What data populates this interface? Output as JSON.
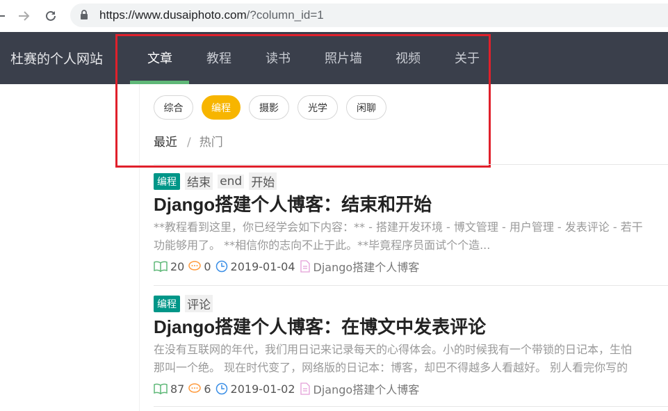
{
  "browser": {
    "url_host": "https://www.dusaiphoto.com",
    "url_path": "/?column_id=1"
  },
  "navbar": {
    "brand": "杜赛的个人网站",
    "items": [
      {
        "label": "文章",
        "active": true
      },
      {
        "label": "教程",
        "active": false
      },
      {
        "label": "读书",
        "active": false
      },
      {
        "label": "照片墙",
        "active": false
      },
      {
        "label": "视频",
        "active": false
      },
      {
        "label": "关于",
        "active": false
      }
    ]
  },
  "filters": {
    "columns": [
      {
        "label": "综合",
        "active": false
      },
      {
        "label": "编程",
        "active": true
      },
      {
        "label": "摄影",
        "active": false
      },
      {
        "label": "光学",
        "active": false
      },
      {
        "label": "闲聊",
        "active": false
      }
    ],
    "sort_latest": "最近",
    "sort_separator": "/",
    "sort_hot": "热门"
  },
  "articles": [
    {
      "category": "编程",
      "tags": [
        "结束",
        "end",
        "开始"
      ],
      "title": "Django搭建个人博客：结束和开始",
      "excerpt_line1": "**教程看到这里，你已经学会如下内容：** - 搭建开发环境 - 博文管理 - 用户管理 - 发表评论 - 若干",
      "excerpt_line2": "功能够用了。 **相信你的志向不止于此。**毕竟程序员面试个个造...",
      "views": "20",
      "comments": "0",
      "date": "2019-01-04",
      "series": "Django搭建个人博客"
    },
    {
      "category": "编程",
      "tags": [
        "评论"
      ],
      "title": "Django搭建个人博客：在博文中发表评论",
      "excerpt_line1": "在没有互联网的年代，我们用日记来记录每天的心得体会。小的时候我有一个带锁的日记本，生怕",
      "excerpt_line2": "那叫一个绝。 现在时代变了，网络版的日记本：博客，却巴不得越多人看越好。 别人看完你写的",
      "views": "87",
      "comments": "6",
      "date": "2019-01-02",
      "series": "Django搭建个人博客"
    }
  ],
  "colors": {
    "navbar_bg": "#3a3f4b",
    "active_underline": "#5fb878",
    "chip_active": "#f7b500",
    "category_badge": "#009688",
    "highlight_box": "#e0202b"
  }
}
